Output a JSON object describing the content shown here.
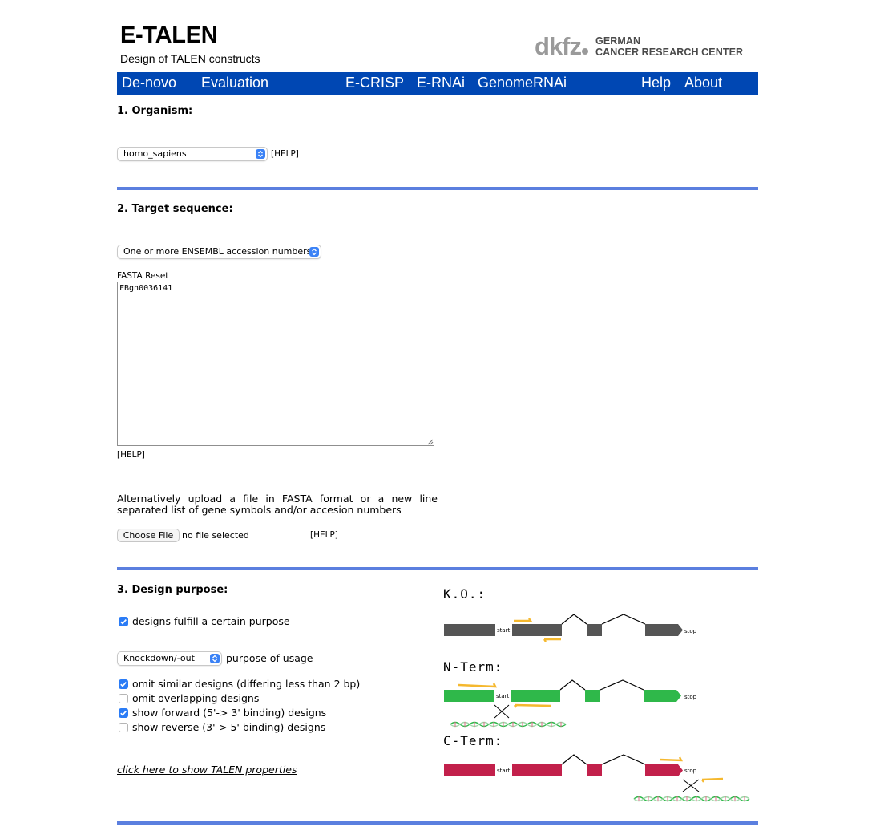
{
  "header": {
    "title": "E-TALEN",
    "subtitle": "Design of TALEN constructs",
    "logo_mark": "dkfz",
    "logo_line1": "GERMAN",
    "logo_line2": "CANCER RESEARCH CENTER"
  },
  "nav": {
    "items": [
      "De-novo",
      "Evaluation",
      "E-CRISP",
      "E-RNAi",
      "GenomeRNAi",
      "Help",
      "About"
    ],
    "color": "#0047b3"
  },
  "organism": {
    "heading": "1. Organism:",
    "selected": "homo_sapiens",
    "help": "[HELP]"
  },
  "target": {
    "heading": "2. Target sequence:",
    "input_type": "One or more ENSEMBL accession numbers",
    "fasta_label": "FASTA",
    "reset_label": "Reset",
    "sequence": "FBgn0036141",
    "help": "[HELP]",
    "alt_text": "Alternatively upload a file in FASTA format or a new line separated list of gene symbols and/or accesion numbers",
    "choose_file": "Choose File",
    "no_file": "no file selected",
    "upload_help": "[HELP]"
  },
  "purpose": {
    "heading": "3. Design purpose:",
    "fulfill_label": "designs fulfill a certain purpose",
    "fulfill_checked": true,
    "usage_selected": "Knockdown/-out",
    "usage_label": "purpose of usage",
    "options": [
      {
        "label": "omit similar designs (differing less than 2 bp)",
        "checked": true
      },
      {
        "label": "omit overlapping designs",
        "checked": false
      },
      {
        "label": "show forward (5'-> 3' binding) designs",
        "checked": true
      },
      {
        "label": "show reverse (3'-> 5' binding) designs",
        "checked": false
      }
    ],
    "properties_link": "click here to show TALEN properties"
  },
  "diagrams": {
    "ko_title": "K.O.:",
    "nterm_title": "N-Term:",
    "cterm_title": "C-Term:",
    "start_label": "start",
    "stop_label": "stop",
    "colors": {
      "ko": "#555555",
      "nterm": "#2fb84a",
      "cterm": "#c2204b",
      "talen": "#f5b82e",
      "divider": "#5b7fdf"
    }
  }
}
